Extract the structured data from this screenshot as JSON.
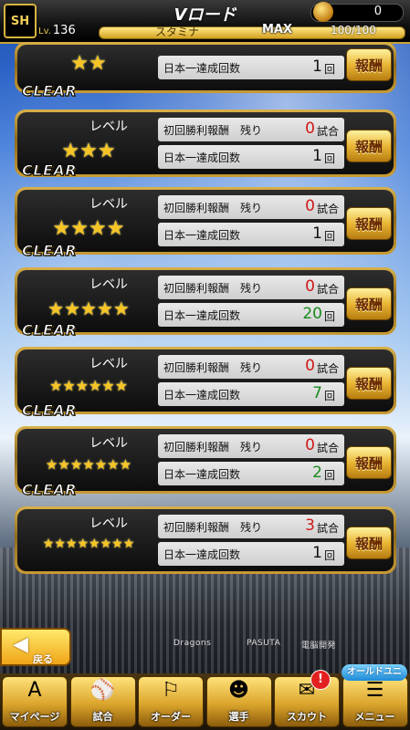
{
  "header": {
    "logo": "SH",
    "title": "Vロード",
    "coins": "0",
    "level_prefix": "Lv.",
    "level": "136",
    "stamina_label": "スタミナ",
    "stamina_max": "MAX",
    "stamina_value": "100/100",
    "icons": {
      "coin": "coin-icon"
    }
  },
  "cards": [
    {
      "clear": "",
      "level_label": "",
      "stars": 2,
      "first_win_label": "",
      "first_win_remaining": "",
      "first_win_unit": "",
      "japan_label": "日本一達成回数",
      "japan_count": "1",
      "japan_unit": "回",
      "reward_label": "報酬"
    },
    {
      "clear": "CLEAR",
      "level_label": "レベル",
      "stars": 3,
      "first_win_label": "初回勝利報酬　残り",
      "first_win_remaining": "0",
      "first_win_unit": "試合",
      "japan_label": "日本一達成回数",
      "japan_count": "1",
      "japan_unit": "回",
      "reward_label": "報酬"
    },
    {
      "clear": "CLEAR",
      "level_label": "レベル",
      "stars": 4,
      "first_win_label": "初回勝利報酬　残り",
      "first_win_remaining": "0",
      "first_win_unit": "試合",
      "japan_label": "日本一達成回数",
      "japan_count": "1",
      "japan_unit": "回",
      "reward_label": "報酬"
    },
    {
      "clear": "CLEAR",
      "level_label": "レベル",
      "stars": 5,
      "first_win_label": "初回勝利報酬　残り",
      "first_win_remaining": "0",
      "first_win_unit": "試合",
      "japan_label": "日本一達成回数",
      "japan_count": "20",
      "japan_unit": "回",
      "reward_label": "報酬"
    },
    {
      "clear": "CLEAR",
      "level_label": "レベル",
      "stars": 6,
      "first_win_label": "初回勝利報酬　残り",
      "first_win_remaining": "0",
      "first_win_unit": "試合",
      "japan_label": "日本一達成回数",
      "japan_count": "7",
      "japan_unit": "回",
      "reward_label": "報酬"
    },
    {
      "clear": "CLEAR",
      "level_label": "レベル",
      "stars": 7,
      "first_win_label": "初回勝利報酬　残り",
      "first_win_remaining": "0",
      "first_win_unit": "試合",
      "japan_label": "日本一達成回数",
      "japan_count": "2",
      "japan_unit": "回",
      "reward_label": "報酬"
    },
    {
      "clear": "CLEAR",
      "level_label": "レベル",
      "stars": 8,
      "first_win_label": "初回勝利報酬　残り",
      "first_win_remaining": "3",
      "first_win_unit": "試合",
      "japan_label": "日本一達成回数",
      "japan_count": "1",
      "japan_unit": "回",
      "reward_label": "報酬"
    }
  ],
  "colors": {
    "remaining_zero": "#d01818",
    "remaining_nonzero": "#d01818",
    "japan_count_green": "#188a1c",
    "japan_count_default": "#111111"
  },
  "stadium_signs": [
    "Dragons",
    "PASUTA",
    "電脳開発"
  ],
  "back": {
    "label": "戻る",
    "icon": "back-arrow-icon"
  },
  "nav": [
    {
      "label": "マイページ",
      "icon": "my-page-icon",
      "glyph": "A"
    },
    {
      "label": "試合",
      "icon": "match-icon",
      "glyph": "⚾"
    },
    {
      "label": "オーダー",
      "icon": "order-icon",
      "glyph": "⚐"
    },
    {
      "label": "選手",
      "icon": "player-icon",
      "glyph": "☻"
    },
    {
      "label": "スカウト",
      "icon": "scout-icon",
      "glyph": "✉"
    },
    {
      "label": "メニュー",
      "icon": "menu-icon",
      "glyph": "☰"
    }
  ],
  "scout_badge": "!",
  "old_uniform": "オールドユニ"
}
